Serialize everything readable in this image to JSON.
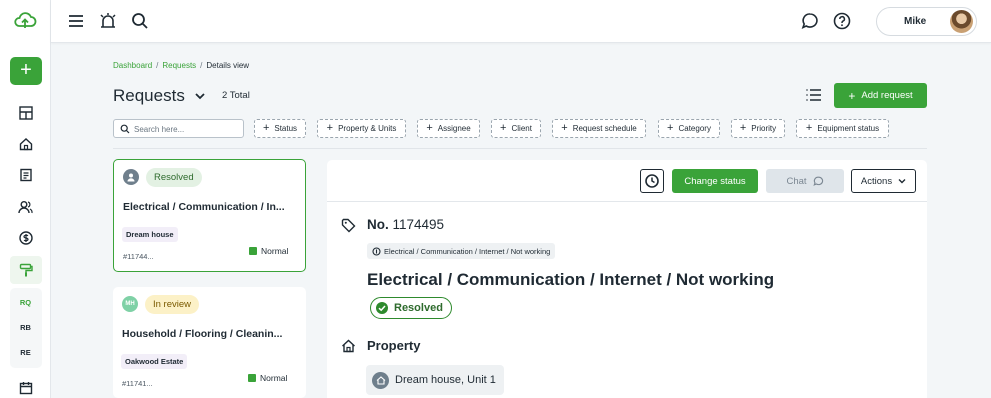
{
  "sidebar": {
    "short_items": [
      "RQ",
      "RB",
      "RE"
    ]
  },
  "topbar": {
    "user_name": "Mike"
  },
  "breadcrumb": {
    "items": [
      "Dashboard",
      "Requests",
      "Details view"
    ]
  },
  "header": {
    "title": "Requests",
    "total": "2 Total",
    "add_button": "Add request"
  },
  "filters": {
    "search_placeholder": "Search here...",
    "items": [
      "Status",
      "Property & Units",
      "Assignee",
      "Client",
      "Request schedule",
      "Category",
      "Priority",
      "Equipment status"
    ]
  },
  "requests": [
    {
      "avatar": "",
      "status": "Resolved",
      "title": "Electrical / Communication / In...",
      "property": "Dream house",
      "id": "#11744...",
      "priority": "Normal"
    },
    {
      "avatar": "MH",
      "status": "In review",
      "title": "Household / Flooring / Cleanin...",
      "property": "Oakwood Estate",
      "id": "#11741...",
      "priority": "Normal"
    }
  ],
  "detail": {
    "toolbar": {
      "change_status": "Change status",
      "chat": "Chat",
      "actions": "Actions"
    },
    "number_label": "No.",
    "number": "1174495",
    "category_chip": "Electrical / Communication / Internet / Not working",
    "title": "Electrical / Communication / Internet / Not working",
    "status": "Resolved",
    "property_heading": "Property",
    "property_unit": "Dream house, Unit 1"
  },
  "colors": {
    "brand_green": "#3aa339",
    "resolved_bg": "#e3f1e3",
    "in_review_bg": "#fcf1c7"
  }
}
